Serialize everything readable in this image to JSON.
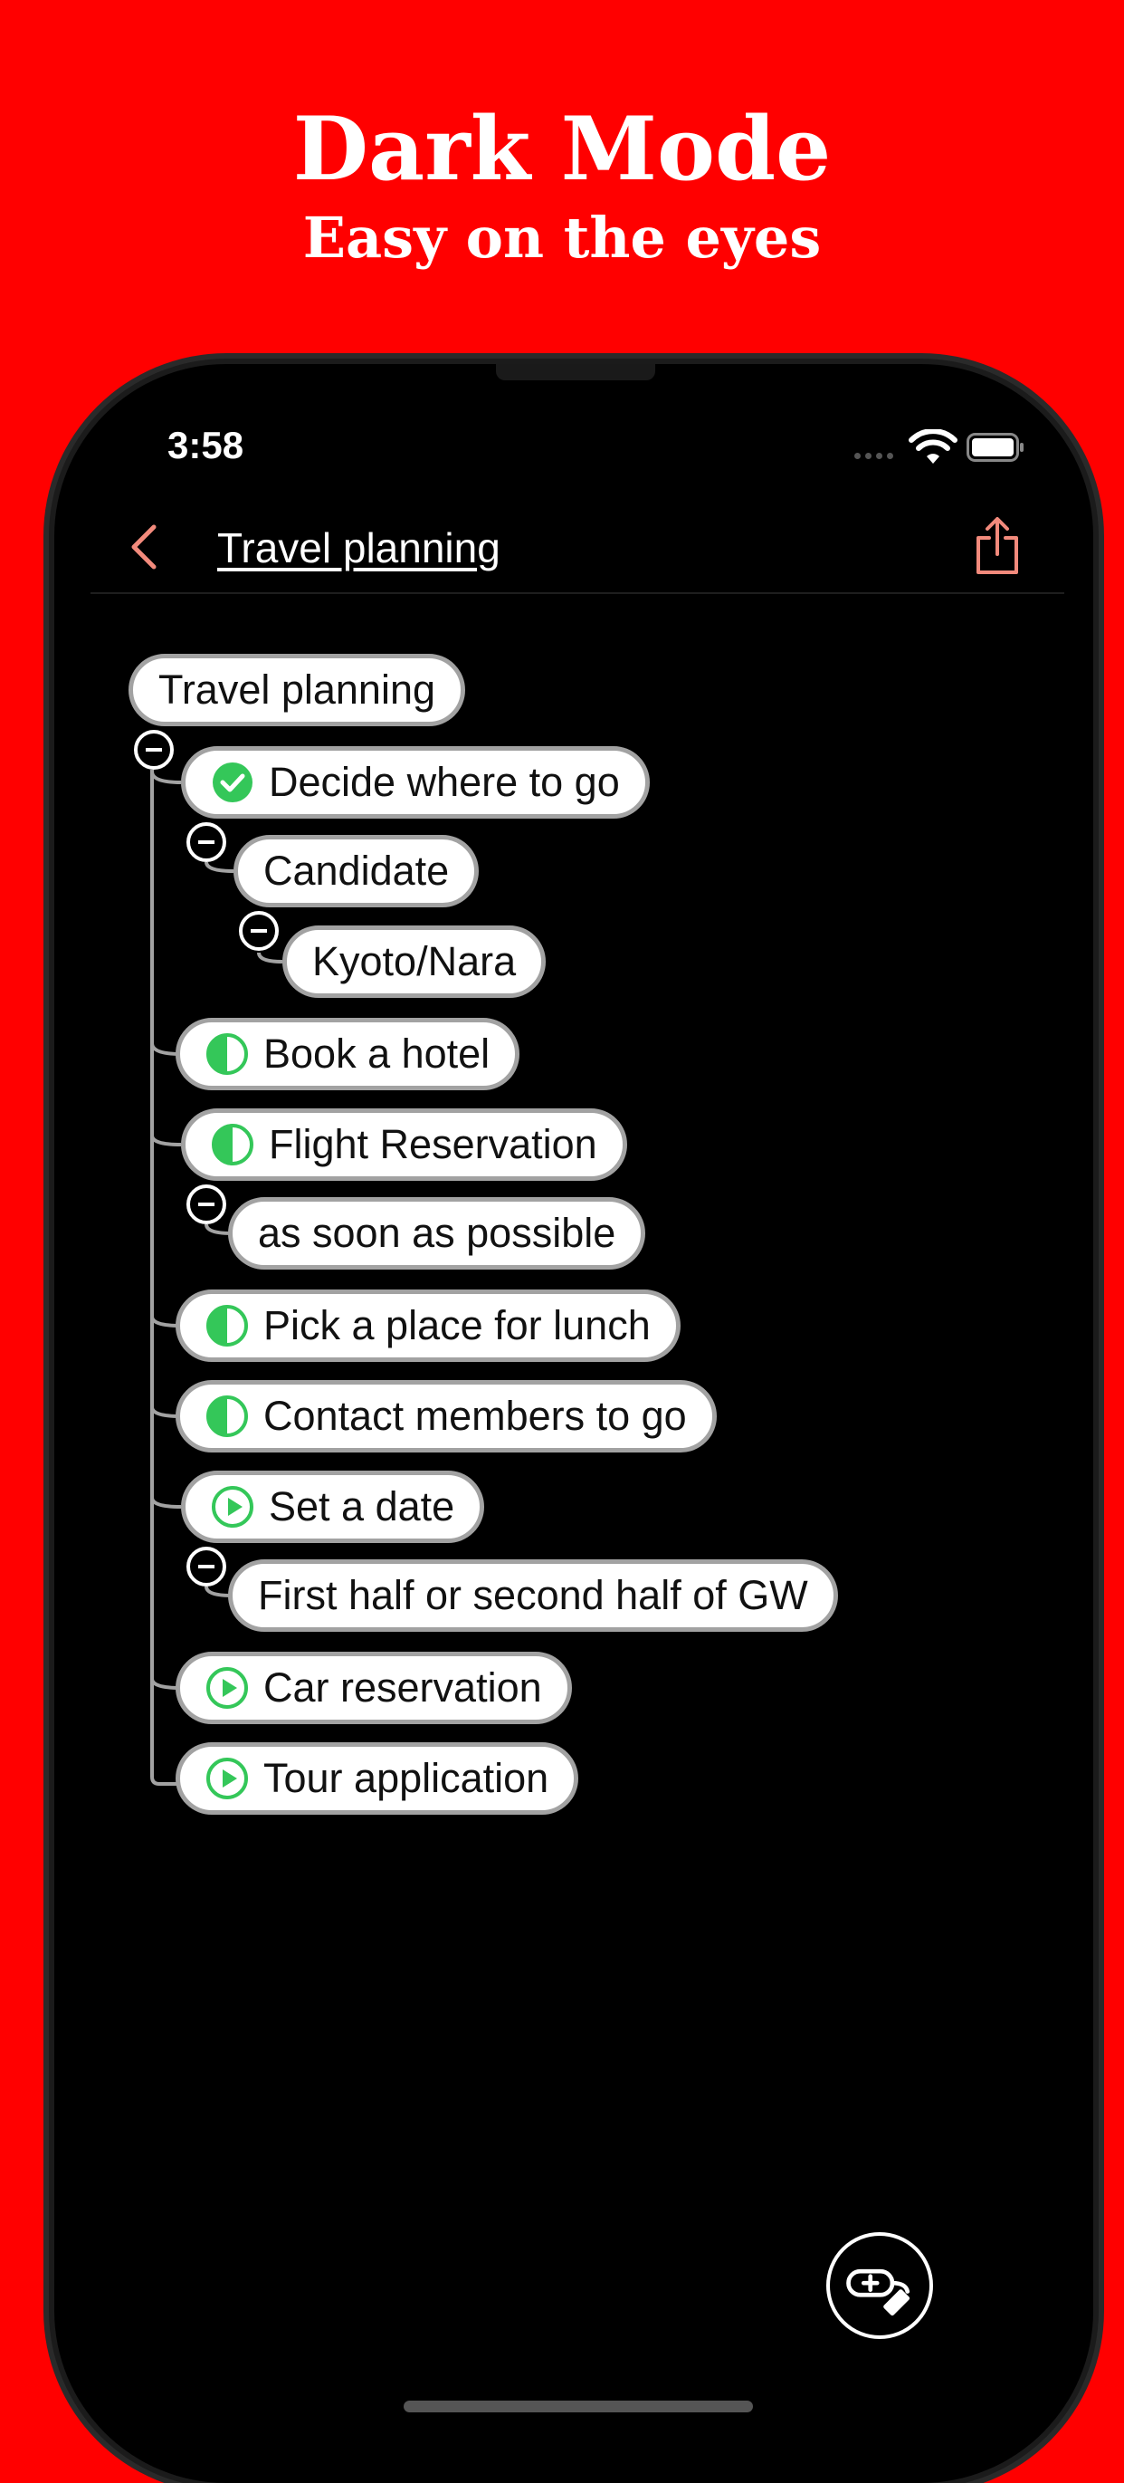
{
  "promo": {
    "headline": "Dark Mode",
    "subheadline": "Easy on the eyes"
  },
  "status_bar": {
    "time": "3:58"
  },
  "nav": {
    "title": "Travel planning"
  },
  "tree": {
    "root": "Travel planning",
    "nodes": [
      {
        "label": "Decide where to go",
        "status": "done"
      },
      {
        "label": "Candidate",
        "status": "none"
      },
      {
        "label": "Kyoto/Nara",
        "status": "none"
      },
      {
        "label": "Book a hotel",
        "status": "in-progress"
      },
      {
        "label": "Flight Reservation",
        "status": "in-progress"
      },
      {
        "label": "as soon as possible",
        "status": "none"
      },
      {
        "label": "Pick a place for lunch",
        "status": "in-progress"
      },
      {
        "label": "Contact members to go",
        "status": "in-progress"
      },
      {
        "label": "Set a date",
        "status": "not-started"
      },
      {
        "label": "First half or second half of GW",
        "status": "none"
      },
      {
        "label": "Car reservation",
        "status": "not-started"
      },
      {
        "label": "Tour application",
        "status": "not-started"
      }
    ]
  },
  "colors": {
    "background": "#ff0000",
    "accent": "#f28a7c",
    "status_green": "#34c759",
    "node_border": "#a2a2a2",
    "connector": "#a2a2a2"
  },
  "icons": {
    "back": "chevron-left-icon",
    "share": "share-icon",
    "done": "check-circle-icon",
    "in_progress": "half-circle-icon",
    "not_started": "play-circle-icon",
    "collapse": "minus-circle-icon",
    "add": "add-node-icon"
  }
}
